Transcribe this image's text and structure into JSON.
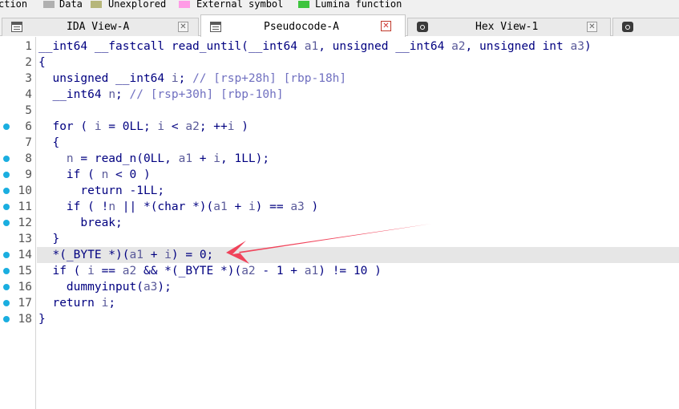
{
  "legend": {
    "items": [
      {
        "label": "ction",
        "color": ""
      },
      {
        "label": "Data",
        "color": "#b0b0b0"
      },
      {
        "label": "Unexplored",
        "color": "#b6b67a"
      },
      {
        "label": "External symbol",
        "color": "#ff9be6"
      },
      {
        "label": "Lumina function",
        "color": "#3ec43e"
      }
    ]
  },
  "tabs": [
    {
      "label": "IDA View-A",
      "icon": "list-window-icon",
      "active": false
    },
    {
      "label": "Pseudocode-A",
      "icon": "list-window-icon",
      "active": true
    },
    {
      "label": "Hex View-1",
      "icon": "hex-view-icon",
      "active": false
    },
    {
      "label": "",
      "icon": "info-icon",
      "active": false
    }
  ],
  "code": {
    "lines": [
      {
        "num": "1",
        "bp": false,
        "text": "__int64 __fastcall read_until(__int64 a1, unsigned __int64 a2, unsigned int a3)"
      },
      {
        "num": "2",
        "bp": false,
        "text": "{"
      },
      {
        "num": "3",
        "bp": false,
        "text": "  unsigned __int64 i; // [rsp+28h] [rbp-18h]"
      },
      {
        "num": "4",
        "bp": false,
        "text": "  __int64 n; // [rsp+30h] [rbp-10h]"
      },
      {
        "num": "5",
        "bp": false,
        "text": ""
      },
      {
        "num": "6",
        "bp": true,
        "text": "  for ( i = 0LL; i < a2; ++i )"
      },
      {
        "num": "7",
        "bp": false,
        "text": "  {"
      },
      {
        "num": "8",
        "bp": true,
        "text": "    n = read_n(0LL, a1 + i, 1LL);"
      },
      {
        "num": "9",
        "bp": true,
        "text": "    if ( n < 0 )"
      },
      {
        "num": "10",
        "bp": true,
        "text": "      return -1LL;"
      },
      {
        "num": "11",
        "bp": true,
        "text": "    if ( !n || *(char *)(a1 + i) == a3 )"
      },
      {
        "num": "12",
        "bp": true,
        "text": "      break;"
      },
      {
        "num": "13",
        "bp": false,
        "text": "  }"
      },
      {
        "num": "14",
        "bp": true,
        "text": "  *(_BYTE *)(a1 + i) = 0;"
      },
      {
        "num": "15",
        "bp": true,
        "text": "  if ( i == a2 && *(_BYTE *)(a2 - 1 + a1) != 10 )"
      },
      {
        "num": "16",
        "bp": true,
        "text": "    dummyinput(a3);"
      },
      {
        "num": "17",
        "bp": true,
        "text": "  return i;"
      },
      {
        "num": "18",
        "bp": true,
        "text": "}"
      }
    ],
    "highlighted_line": "14"
  },
  "colors": {
    "keyword": "#000080",
    "variable": "#5a5a9a",
    "comment": "#7070c0",
    "breakpoint": "#1aaee0",
    "annotation_arrow": "#f0435a"
  }
}
